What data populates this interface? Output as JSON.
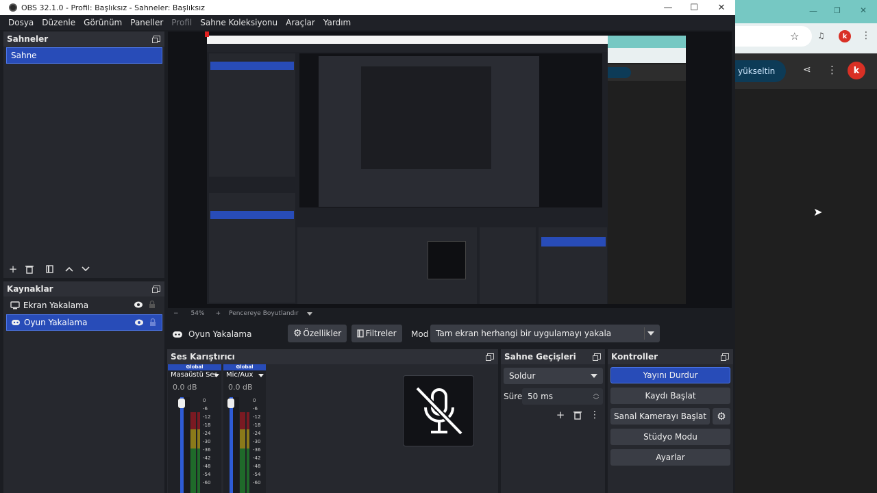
{
  "window": {
    "title": "OBS 32.1.0 - Profil: Başlıksız - Sahneler: Başlıksız"
  },
  "menu": {
    "items": [
      "Dosya",
      "Düzenle",
      "Görünüm",
      "Paneller",
      "Profil",
      "Sahne Koleksiyonu",
      "Araçlar",
      "Yardım"
    ]
  },
  "scenes": {
    "title": "Sahneler",
    "items": [
      "Sahne"
    ]
  },
  "sources": {
    "title": "Kaynaklar",
    "items": [
      "Ekran Yakalama",
      "Oyun Yakalama"
    ]
  },
  "preview_bar": {
    "zoom": "54%",
    "resize_label": "Pencereye Boyutlandır"
  },
  "source_bar": {
    "selected_source": "Oyun Yakalama",
    "properties": "Özellikler",
    "filters": "Filtreler",
    "mode_label": "Mod",
    "mode_value": "Tam ekran herhangi bir uygulamayı yakala"
  },
  "mixer": {
    "title": "Ses Karıştırıcı",
    "channels": [
      {
        "header": "Global",
        "name": "Masaüstü Ses",
        "db": "0.0 dB"
      },
      {
        "header": "Global",
        "name": "Mic/Aux",
        "db": "0.0 dB"
      }
    ],
    "scale": [
      "0",
      "-6",
      "-12",
      "-18",
      "-24",
      "-30",
      "-36",
      "-42",
      "-48",
      "-54",
      "-60"
    ]
  },
  "transitions": {
    "title": "Sahne Geçişleri",
    "type": "Soldur",
    "duration_label": "Süre",
    "duration_value": "50 ms"
  },
  "controls": {
    "title": "Kontroller",
    "buttons": [
      "Yayını Durdur",
      "Kaydı Başlat",
      "Sanal Kamerayı Başlat",
      "Stüdyo Modu",
      "Ayarlar"
    ]
  },
  "browser": {
    "button_label": "yükseltin",
    "avatar_letter": "k"
  },
  "colors": {
    "accent": "#284cb8",
    "panel": "#26282e",
    "background": "#1b1d22"
  }
}
